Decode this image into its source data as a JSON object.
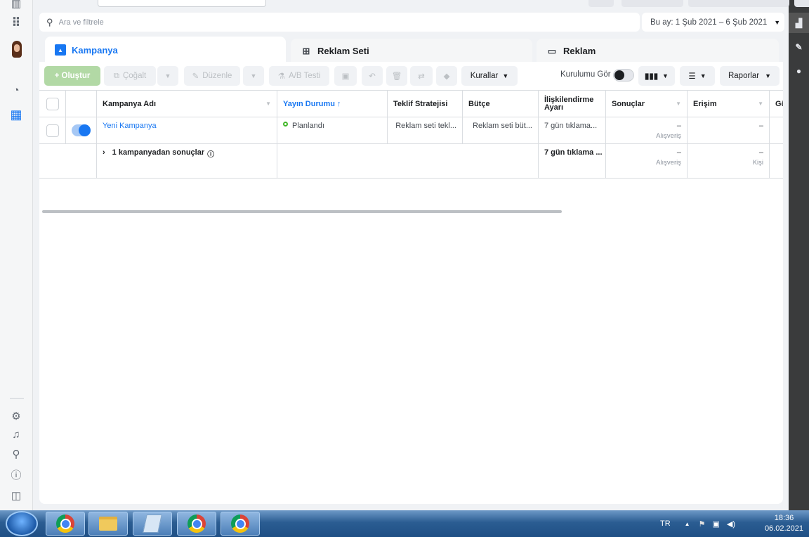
{
  "search": {
    "placeholder": "Ara ve filtrele"
  },
  "date_range": {
    "label": "Bu ay: 1 Şub 2021 – 6 Şub 2021"
  },
  "tabs": [
    {
      "label": "Kampanya",
      "active": true,
      "icon": "campaign-folder-icon"
    },
    {
      "label": "Reklam Seti",
      "active": false,
      "icon": "ad-set-grid-icon"
    },
    {
      "label": "Reklam",
      "active": false,
      "icon": "ad-window-icon"
    }
  ],
  "toolbar": {
    "create": "+ Oluştur",
    "duplicate": "Çoğalt",
    "edit": "Düzenle",
    "ab_test": "A/B Testi",
    "rules": "Kurallar",
    "view_setup": "Kurulumu Gör",
    "reports": "Raporlar"
  },
  "table": {
    "headers": {
      "name": "Kampanya Adı",
      "delivery": "Yayın Durumu ↑",
      "bid": "Teklif Stratejisi",
      "budget": "Bütçe",
      "attribution": "İlişkilendirme Ayarı",
      "results": "Sonuçlar",
      "reach": "Erişim",
      "cut": "Gö"
    },
    "row": {
      "name": "Yeni Kampanya",
      "delivery": "Planlandı",
      "bid": "Reklam seti tekl...",
      "budget": "Reklam seti büt...",
      "attribution": "7 gün tıklama...",
      "results": "–",
      "results_sub": "Alışveriş",
      "reach": "–"
    },
    "summary": {
      "label": "1 kampanyadan sonuçlar",
      "attribution": "7 gün tıklama ...",
      "results": "–",
      "results_sub": "Alışveriş",
      "reach": "–",
      "reach_sub": "Kişi"
    }
  },
  "taskbar": {
    "lang": "TR",
    "time": "18:36",
    "date": "06.02.2021"
  },
  "colors": {
    "accent": "#1877f2",
    "create": "#b2d9a5",
    "status_ok": "#42b72a"
  }
}
